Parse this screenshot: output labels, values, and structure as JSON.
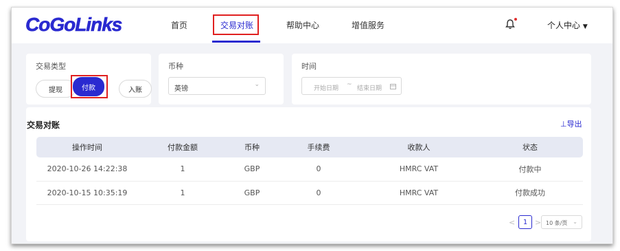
{
  "brand": {
    "logo_text": "CoGoLinks",
    "color": "#2a2ad0"
  },
  "nav": {
    "items": [
      {
        "label": "首页"
      },
      {
        "label": "交易对账"
      },
      {
        "label": "帮助中心"
      },
      {
        "label": "增值服务"
      }
    ],
    "active": "交易对账",
    "notification_icon": "bell-icon",
    "user_menu": "个人中心",
    "user_menu_icon": "caret-down-icon"
  },
  "filters": {
    "type": {
      "label": "交易类型",
      "options": [
        "提现",
        "付款",
        "入账"
      ],
      "selected": "付款"
    },
    "currency": {
      "label": "币种",
      "value": "英镑"
    },
    "time": {
      "label": "时间",
      "start_placeholder": "开始日期",
      "separator": "~",
      "end_placeholder": "结束日期",
      "calendar_icon": "calendar-icon"
    }
  },
  "main": {
    "title": "交易对账",
    "export_label": "⊥导出",
    "table": {
      "headers": [
        "操作时间",
        "付款金额",
        "币种",
        "手续费",
        "收款人",
        "状态"
      ],
      "rows": [
        [
          "2020-10-26 14:22:38",
          "1",
          "GBP",
          "0",
          "HMRC VAT",
          "付款中"
        ],
        [
          "2020-10-15 10:35:19",
          "1",
          "GBP",
          "0",
          "HMRC VAT",
          "付款成功"
        ]
      ]
    },
    "pagination": {
      "prev": "<",
      "current_page": "1",
      "next": ">",
      "page_size": "10 条/页"
    }
  },
  "colors": {
    "accent": "#2a2ad0",
    "highlight_box": "#e02020",
    "background": "#f2f3f7",
    "table_header": "#e6e9f3"
  }
}
